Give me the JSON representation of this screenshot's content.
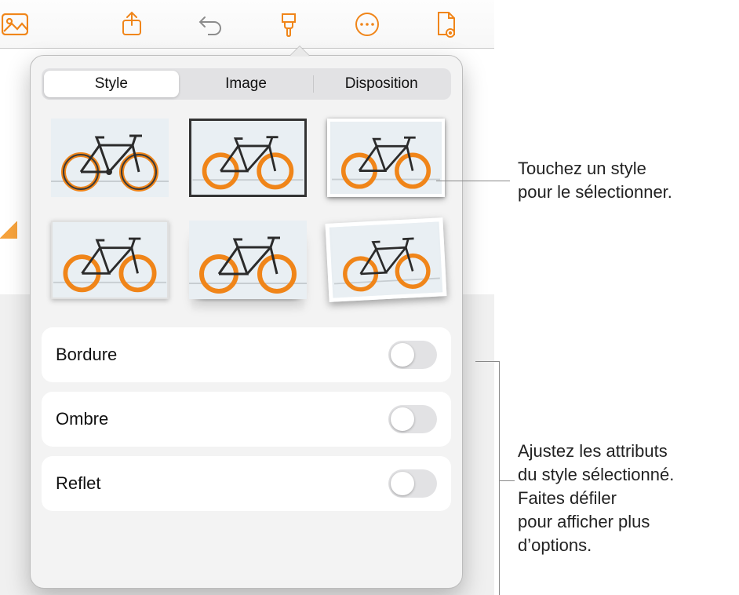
{
  "toolbar": {
    "icons": [
      "photos-icon",
      "share-icon",
      "undo-icon",
      "format-brush-icon",
      "more-icon",
      "document-view-icon"
    ]
  },
  "popover": {
    "tabs": [
      {
        "label": "Style",
        "selected": true
      },
      {
        "label": "Image",
        "selected": false
      },
      {
        "label": "Disposition",
        "selected": false
      }
    ],
    "thumbnails_count": 6,
    "options": [
      {
        "label": "Bordure",
        "on": false
      },
      {
        "label": "Ombre",
        "on": false
      },
      {
        "label": "Reflet",
        "on": false
      }
    ]
  },
  "callouts": {
    "c1_line1": "Touchez un style",
    "c1_line2": "pour le sélectionner.",
    "c2_line1": "Ajustez les attributs",
    "c2_line2": "du style sélectionné.",
    "c2_line3": "Faites défiler",
    "c2_line4": "pour afficher plus",
    "c2_line5": "d’options."
  },
  "colors": {
    "accent": "#f08519"
  }
}
